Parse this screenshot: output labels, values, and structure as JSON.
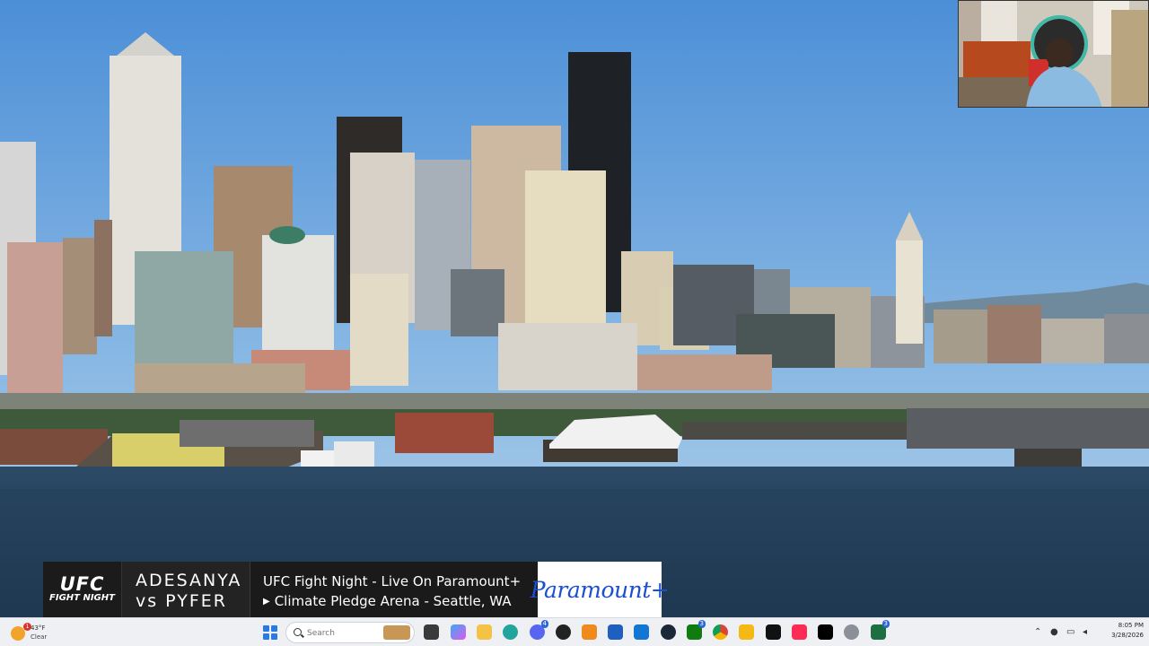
{
  "broadcast": {
    "lower_third": {
      "logo_line1": "UFC",
      "logo_line2": "FIGHT NIGHT",
      "fighter_a": "ADESANYA",
      "fighter_b": "vs PYFER",
      "event_line1": "UFC Fight Night - Live On Paramount+",
      "event_line2": "Climate Pledge Arena - Seattle, WA",
      "sponsor": "Paramount+"
    }
  },
  "taskbar": {
    "weather": {
      "temp": "43°F",
      "condition": "Clear",
      "badge": "1",
      "icon": "sun-icon"
    },
    "search": {
      "placeholder": "Search"
    },
    "apps": [
      {
        "name": "start-icon"
      },
      {
        "name": "task-view-icon"
      },
      {
        "name": "copilot-icon"
      },
      {
        "name": "file-explorer-icon"
      },
      {
        "name": "edge-icon"
      },
      {
        "name": "discord-icon",
        "badge": "4"
      },
      {
        "name": "obs-icon"
      },
      {
        "name": "vlc-icon"
      },
      {
        "name": "store-icon"
      },
      {
        "name": "outlook-icon"
      },
      {
        "name": "steam-icon"
      },
      {
        "name": "xbox-icon",
        "badge": "3"
      },
      {
        "name": "chrome-icon"
      },
      {
        "name": "rockstar-icon"
      },
      {
        "name": "fullbright-icon"
      },
      {
        "name": "tiktok-live-icon"
      },
      {
        "name": "tiktok-icon"
      },
      {
        "name": "settings-icon"
      },
      {
        "name": "excel-icon",
        "badge": "3"
      }
    ],
    "clock": {
      "time": "8:05 PM",
      "date": "3/28/2026"
    }
  }
}
